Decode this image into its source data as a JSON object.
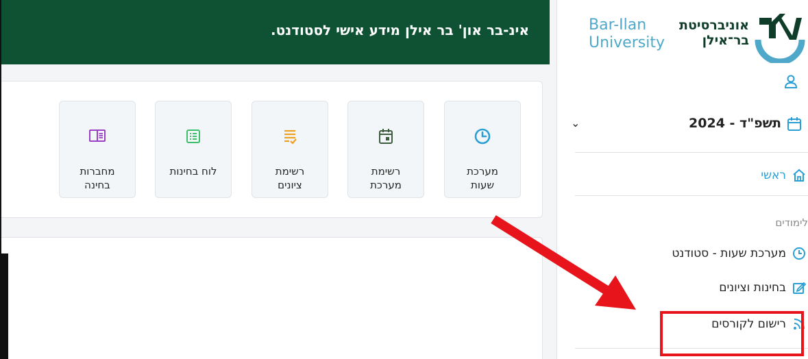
{
  "banner": {
    "text": "אינ-בר און' בר אילן מידע אישי לסטודנט."
  },
  "tiles": [
    {
      "label": "מערכת\nשעות",
      "icon": "clock-icon"
    },
    {
      "label": "רשימת\nמערכת",
      "icon": "calendar-icon"
    },
    {
      "label": "רשימת\nציונים",
      "icon": "list-check-icon"
    },
    {
      "label": "לוח בחינות",
      "icon": "grid-list-icon"
    },
    {
      "label": "מחברות\nבחינה",
      "icon": "notebook-icon"
    }
  ],
  "sidebar": {
    "logo": {
      "hebrew_line1": "אוניברסיטת",
      "hebrew_line2": "בר־אילן",
      "english_line1": "Bar-Ilan",
      "english_line2": "University"
    },
    "year": "תשפ\"ד - 2024",
    "home": "ראשי",
    "section_title": "לימודים",
    "items": [
      {
        "label": "מערכת שעות - סטודנט",
        "icon": "clock-icon"
      },
      {
        "label": "בחינות וציונים",
        "icon": "edit-icon"
      },
      {
        "label": "רישום לקורסים",
        "icon": "rss-icon"
      }
    ]
  },
  "colors": {
    "banner": "#0e5233",
    "accent": "#2a9fd6",
    "highlight": "#e8141b"
  }
}
